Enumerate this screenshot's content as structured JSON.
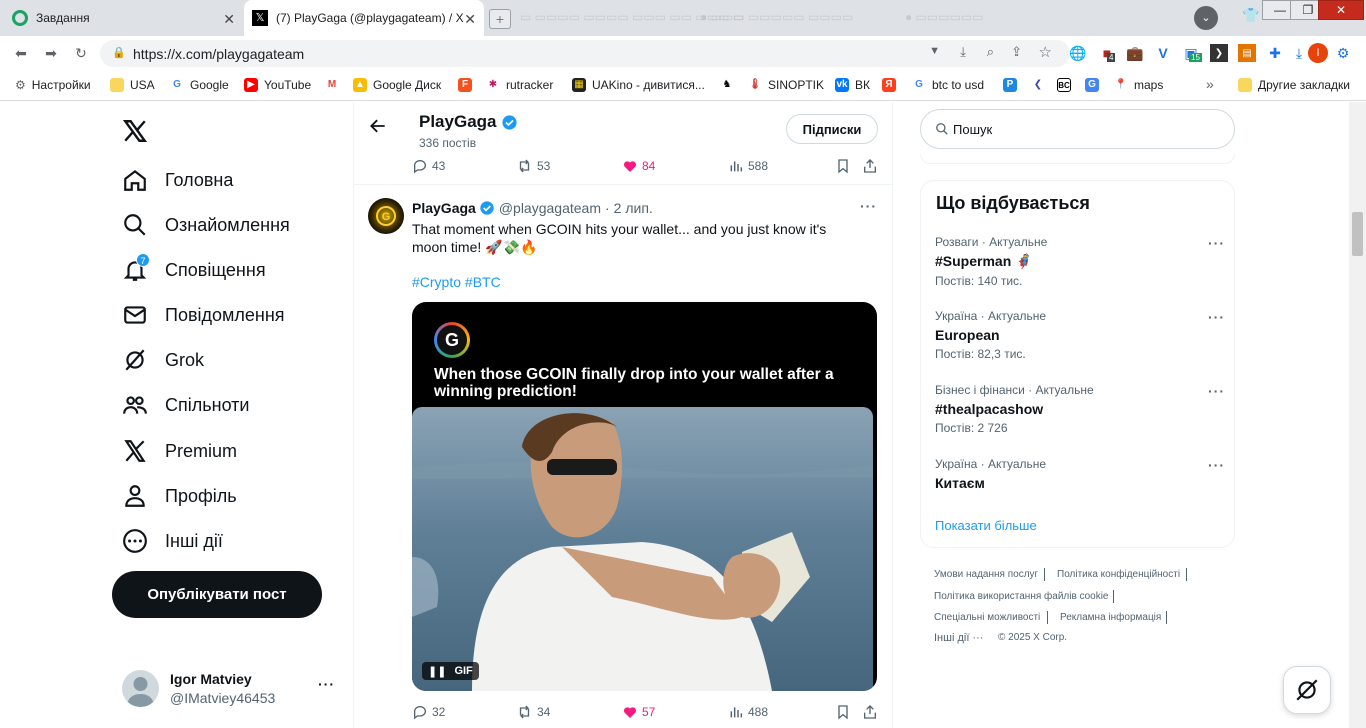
{
  "browser": {
    "tabs": [
      {
        "title": "Завдання",
        "active": false
      },
      {
        "title": "(7) PlayGaga (@playgagateam) / X",
        "active": true
      }
    ],
    "url": "https://x.com/playgagateam",
    "bookmarks": [
      {
        "label": "Настройки",
        "icon": "gear-icon"
      },
      {
        "label": "USA",
        "icon": "folder-icon"
      },
      {
        "label": "Google",
        "icon": "google-icon"
      },
      {
        "label": "YouTube",
        "icon": "youtube-icon"
      },
      {
        "label": "",
        "icon": "gmail-icon"
      },
      {
        "label": "Google Диск",
        "icon": "drive-icon"
      },
      {
        "label": "",
        "icon": "f-icon"
      },
      {
        "label": "rutracker",
        "icon": "rutracker-icon"
      },
      {
        "label": "UAKino - дивитися...",
        "icon": "uakino-icon"
      },
      {
        "label": "",
        "icon": "chess-icon"
      },
      {
        "label": "SINOPTIK",
        "icon": "thermometer-icon"
      },
      {
        "label": "ВК",
        "icon": "vk-icon"
      },
      {
        "label": "",
        "icon": "yandex-icon"
      },
      {
        "label": "btc to usd",
        "icon": "google-icon"
      },
      {
        "label": "",
        "icon": "p-icon"
      },
      {
        "label": "",
        "icon": "arrow-icon"
      },
      {
        "label": "",
        "icon": "bc-icon"
      },
      {
        "label": "",
        "icon": "translate-icon"
      },
      {
        "label": "maps",
        "icon": "maps-icon"
      }
    ],
    "other_bookmarks": "Другие закладки",
    "ext_badges": {
      "shield": "4",
      "tasks": "15"
    },
    "profile_initial": "I"
  },
  "sidebar": {
    "nav": [
      {
        "label": "Головна",
        "icon": "home-icon"
      },
      {
        "label": "Ознайомлення",
        "icon": "search-icon"
      },
      {
        "label": "Сповіщення",
        "icon": "bell-icon",
        "badge": "7"
      },
      {
        "label": "Повідомлення",
        "icon": "mail-icon"
      },
      {
        "label": "Grok",
        "icon": "grok-icon"
      },
      {
        "label": "Спільноти",
        "icon": "communities-icon"
      },
      {
        "label": "Premium",
        "icon": "x-logo-icon"
      },
      {
        "label": "Профіль",
        "icon": "profile-icon"
      },
      {
        "label": "Інші дії",
        "icon": "more-icon"
      }
    ],
    "post_button": "Опублікувати пост",
    "account": {
      "name": "Igor Matviey",
      "handle": "@IMatviey46453"
    }
  },
  "header": {
    "name": "PlayGaga",
    "posts_count": "336 постів",
    "follow_label": "Підписки"
  },
  "prev_post_actions": {
    "replies": "43",
    "reposts": "53",
    "likes": "84",
    "views": "588"
  },
  "post": {
    "name": "PlayGaga",
    "handle": "@playgagateam",
    "sep": "·",
    "date": "2 лип.",
    "text": "That moment when GCOIN hits your wallet... and you just know it's moon time! 🚀💸🔥",
    "hashtags": "#Crypto #BTC",
    "media_caption": "When those GCOIN finally drop into your wallet after a winning prediction!",
    "media_logo_letter": "G",
    "gif_label": "GIF",
    "actions": {
      "replies": "32",
      "reposts": "34",
      "likes": "57",
      "views": "488"
    }
  },
  "search": {
    "placeholder": "Пошук"
  },
  "trends": {
    "title": "Що відбувається",
    "items": [
      {
        "category": "Розваги · Актуальне",
        "name": "#Superman 🦸",
        "count": "Постів: 140 тис."
      },
      {
        "category": "Україна · Актуальне",
        "name": "European",
        "count": "Постів: 82,3 тис."
      },
      {
        "category": "Бізнес і фінанси · Актуальне",
        "name": "#thealpacashow",
        "count": "Постів: 2 726"
      },
      {
        "category": "Україна · Актуальне",
        "name": "Китаєм",
        "count": ""
      }
    ],
    "show_more": "Показати більше"
  },
  "footer": {
    "links": [
      "Умови надання послуг",
      "Політика конфіденційності",
      "Політика використання файлів cookie",
      "Спеціальні можливості",
      "Рекламна інформація",
      "Інші дії ···"
    ],
    "copyright": "© 2025 X Corp."
  },
  "colors": {
    "accent": "#1d9bf0",
    "like": "#f91880",
    "dark": "#0f1419",
    "muted": "#536471"
  }
}
